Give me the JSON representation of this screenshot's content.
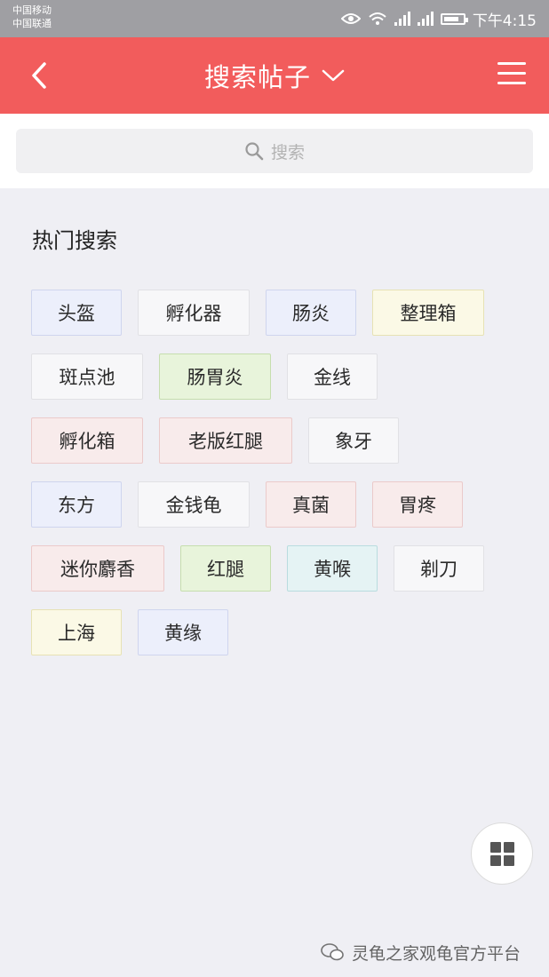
{
  "status_bar": {
    "carrier_1": "中国移动",
    "carrier_2": "中国联通",
    "time": "下午4:15"
  },
  "nav": {
    "title": "搜索帖子"
  },
  "search": {
    "placeholder": "搜索"
  },
  "hot_search": {
    "title": "热门搜索",
    "tags": [
      {
        "label": "头盔",
        "color": "blue"
      },
      {
        "label": "孵化器",
        "color": "white"
      },
      {
        "label": "肠炎",
        "color": "blue"
      },
      {
        "label": "整理箱",
        "color": "yellow"
      },
      {
        "label": "斑点池",
        "color": "white"
      },
      {
        "label": "肠胃炎",
        "color": "green"
      },
      {
        "label": "金线",
        "color": "white"
      },
      {
        "label": "孵化箱",
        "color": "pink"
      },
      {
        "label": "老版红腿",
        "color": "pink"
      },
      {
        "label": "象牙",
        "color": "white"
      },
      {
        "label": "东方",
        "color": "blue"
      },
      {
        "label": "金钱龟",
        "color": "white"
      },
      {
        "label": "真菌",
        "color": "pink"
      },
      {
        "label": "胃疼",
        "color": "pink"
      },
      {
        "label": "迷你麝香",
        "color": "pink"
      },
      {
        "label": "红腿",
        "color": "green"
      },
      {
        "label": "黄喉",
        "color": "cyan"
      },
      {
        "label": "剃刀",
        "color": "white"
      },
      {
        "label": "上海",
        "color": "yellow"
      },
      {
        "label": "黄缘",
        "color": "blue"
      }
    ]
  },
  "watermark": {
    "text": "灵龟之家观龟官方平台"
  },
  "colors": {
    "nav_bg": "#f25c5c",
    "status_bg": "#9f9fa3",
    "page_bg": "#efeff4"
  }
}
